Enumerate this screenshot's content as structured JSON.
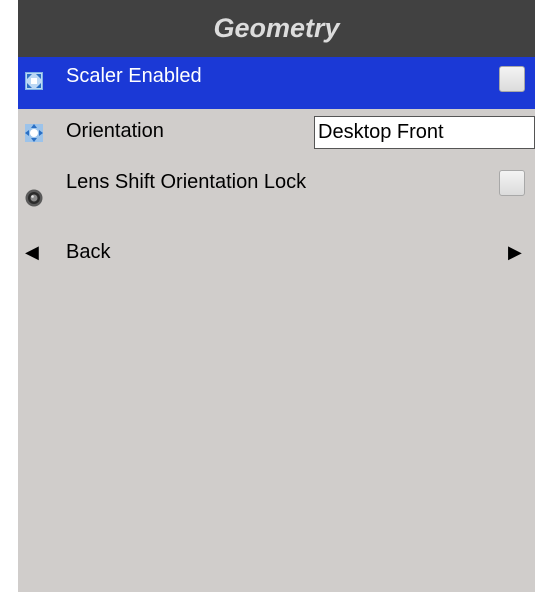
{
  "title": "Geometry",
  "items": [
    {
      "label": "Scaler Enabled",
      "icon": "scaler-icon",
      "checked": false,
      "selected": true
    },
    {
      "label": "Orientation",
      "icon": "orientation-icon",
      "value": "Desktop Front"
    },
    {
      "label": "Lens Shift Orientation Lock",
      "icon": "lens-icon",
      "checked": false
    },
    {
      "label": "Back",
      "icon": "back-arrow-icon"
    }
  ],
  "colors": {
    "title_bg": "#414141",
    "panel_bg": "#d0cdcb",
    "selected_bg": "#1b39d6"
  },
  "icons": {
    "back_left": "◀",
    "back_right": "▶"
  }
}
